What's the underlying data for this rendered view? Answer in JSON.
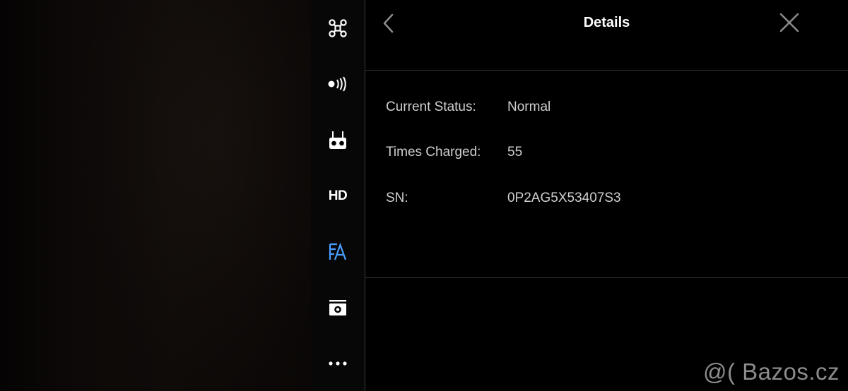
{
  "sidebar": {
    "items": [
      {
        "name": "aircraft",
        "icon": "drone-icon",
        "active": false
      },
      {
        "name": "signal",
        "icon": "signal-icon",
        "active": false
      },
      {
        "name": "remote-controller",
        "icon": "remote-controller-icon",
        "active": false
      },
      {
        "name": "hd",
        "icon": "hd-icon",
        "label": "HD",
        "active": false
      },
      {
        "name": "battery",
        "icon": "battery-icon",
        "active": true
      },
      {
        "name": "camera",
        "icon": "camera-icon",
        "active": false
      },
      {
        "name": "more",
        "icon": "more-icon",
        "active": false
      }
    ]
  },
  "details": {
    "title": "Details",
    "rows": [
      {
        "label": "Current Status:",
        "value": "Normal"
      },
      {
        "label": "Times Charged:",
        "value": "55"
      },
      {
        "label": "SN:",
        "value": "0P2AG5X53407S3"
      }
    ]
  },
  "watermark": "@( Bazos.cz",
  "colors": {
    "active_icon": "#4a9eff",
    "icon": "#ffffff",
    "text": "#cfcfcf",
    "divider": "#2f2f2f"
  }
}
